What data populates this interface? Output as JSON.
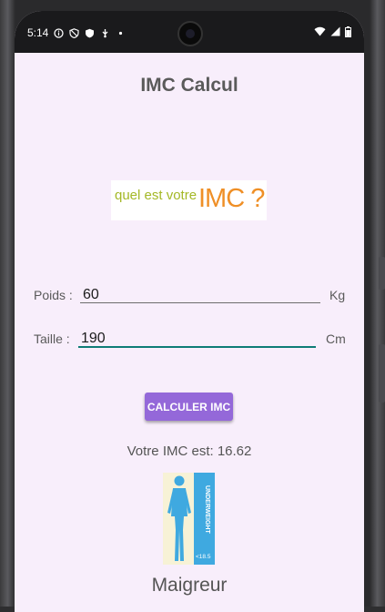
{
  "status": {
    "time": "5:14"
  },
  "app": {
    "title": "IMC Calcul"
  },
  "banner": {
    "text": "quel est votre",
    "imc": "IMC ?"
  },
  "poids": {
    "label": "Poids :",
    "value": "60",
    "unit": "Kg"
  },
  "taille": {
    "label": "Taille :",
    "value": "190",
    "unit": "Cm"
  },
  "action": {
    "calculate_label": "CALCULER IMC"
  },
  "result": {
    "text": "Votre IMC est: 16.62",
    "category": "Maigreur"
  },
  "figure": {
    "vertical_label": "UNDERWEIGHT",
    "threshold": "<18.5"
  },
  "colors": {
    "screen_bg": "#f8eefb",
    "button": "#9468d9",
    "active_underline": "#0e7c76",
    "banner_green": "#a4b826",
    "banner_orange": "#ef8f26",
    "figure_blue": "#3fa9e0"
  }
}
